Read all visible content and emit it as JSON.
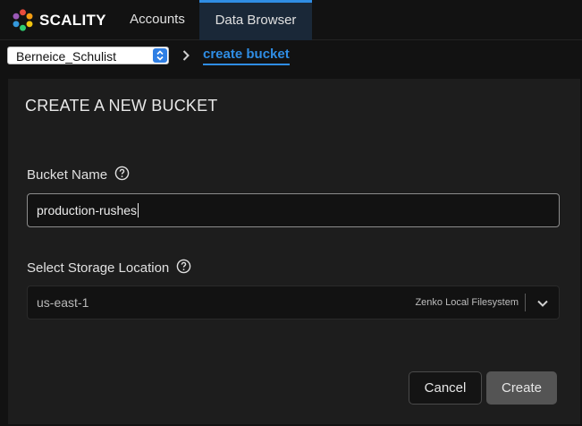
{
  "navbar": {
    "brand": "SCALITY",
    "tabs": [
      {
        "label": "Accounts",
        "active": false
      },
      {
        "label": "Data Browser",
        "active": true
      }
    ]
  },
  "breadcrumb": {
    "account_select_value": "Berneice_Schulist",
    "current": "create bucket"
  },
  "form": {
    "title": "CREATE A NEW BUCKET",
    "bucket_name_label": "Bucket Name",
    "bucket_name_value": "production-rushes",
    "storage_location_label": "Select Storage Location",
    "storage_location_value": "us-east-1",
    "storage_location_type": "Zenko Local Filesystem",
    "cancel_label": "Cancel",
    "create_label": "Create"
  },
  "colors": {
    "accent": "#2f8de4",
    "background": "#121212",
    "panel": "#1d1d1d"
  },
  "icons": [
    "scality-logo-icon",
    "select-arrows-icon",
    "chevron-right-icon",
    "help-circle-icon",
    "chevron-down-icon"
  ]
}
